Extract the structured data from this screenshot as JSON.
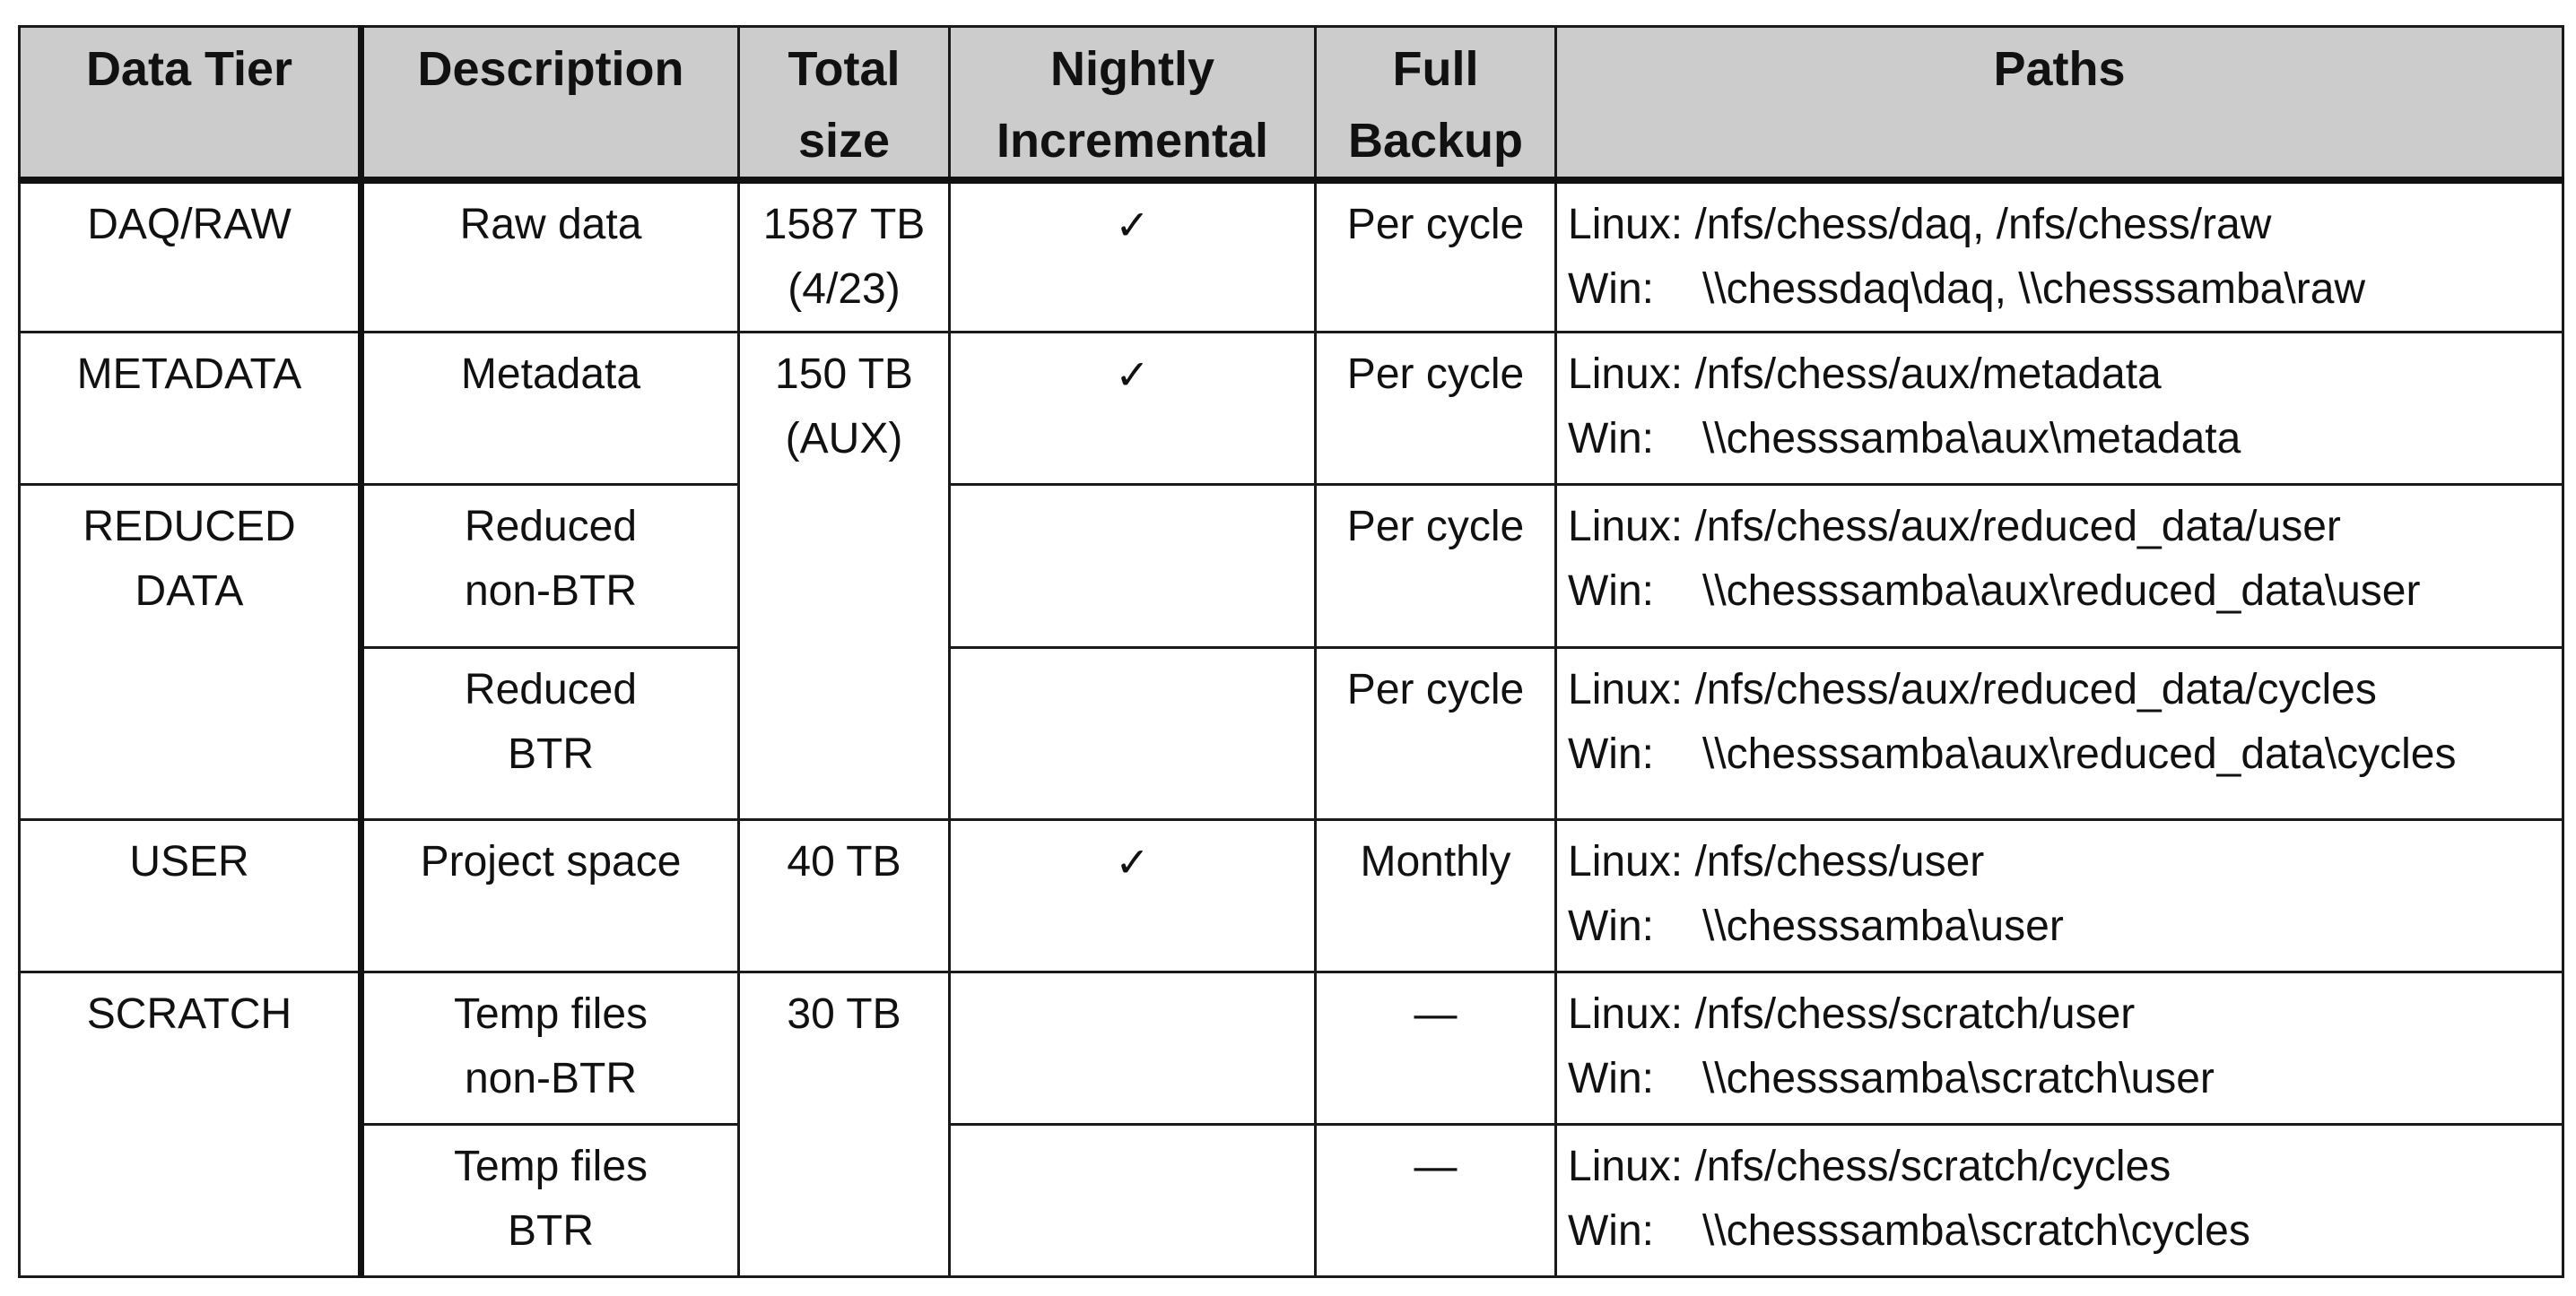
{
  "headers": {
    "data_tier": "Data Tier",
    "description": "Description",
    "total_size": [
      "Total",
      "size"
    ],
    "nightly_incremental": [
      "Nightly",
      "Incremental"
    ],
    "full_backup": [
      "Full",
      "Backup"
    ],
    "paths": "Paths"
  },
  "rows": [
    {
      "tier": [
        "DAQ/RAW"
      ],
      "description": [
        "Raw data"
      ],
      "size": [
        "1587 TB",
        "(4/23)"
      ],
      "nightly": "✓",
      "full": "Per cycle",
      "linux_label": "Linux:",
      "linux": "/nfs/chess/daq, /nfs/chess/raw",
      "win_label": "Win:",
      "win": "\\\\chessdaq\\daq, \\\\chesssamba\\raw"
    },
    {
      "tier": [
        "METADATA"
      ],
      "description": [
        "Metadata"
      ],
      "size": [
        "150 TB",
        "(AUX)"
      ],
      "nightly": "✓",
      "full": "Per cycle",
      "linux_label": "Linux:",
      "linux": "/nfs/chess/aux/metadata",
      "win_label": "Win:",
      "win": "\\\\chesssamba\\aux\\metadata"
    },
    {
      "tier": [
        "REDUCED",
        "DATA"
      ],
      "description": [
        "Reduced",
        "non-BTR"
      ],
      "nightly": "",
      "full": "Per cycle",
      "linux_label": "Linux:",
      "linux": "/nfs/chess/aux/reduced_data/user",
      "win_label": "Win:",
      "win": "\\\\chesssamba\\aux\\reduced_data\\user"
    },
    {
      "description": [
        "Reduced",
        "BTR"
      ],
      "nightly": "",
      "full": "Per cycle",
      "linux_label": "Linux:",
      "linux": "/nfs/chess/aux/reduced_data/cycles",
      "win_label": "Win:",
      "win": "\\\\chesssamba\\aux\\reduced_data\\cycles"
    },
    {
      "tier": [
        "USER"
      ],
      "description": [
        "Project space"
      ],
      "size": [
        "40 TB"
      ],
      "nightly": "✓",
      "full": "Monthly",
      "linux_label": "Linux:",
      "linux": "/nfs/chess/user",
      "win_label": "Win:",
      "win": "\\\\chesssamba\\user"
    },
    {
      "tier": [
        "SCRATCH"
      ],
      "description": [
        "Temp files",
        "non-BTR"
      ],
      "size": [
        "30 TB"
      ],
      "nightly": "",
      "full": "—",
      "linux_label": "Linux:",
      "linux": "/nfs/chess/scratch/user",
      "win_label": "Win:",
      "win": "\\\\chesssamba\\scratch\\user"
    },
    {
      "description": [
        "Temp files",
        "BTR"
      ],
      "nightly": "",
      "full": "—",
      "linux_label": "Linux:",
      "linux": "/nfs/chess/scratch/cycles",
      "win_label": "Win:",
      "win": "\\\\chesssamba\\scratch\\cycles"
    }
  ]
}
